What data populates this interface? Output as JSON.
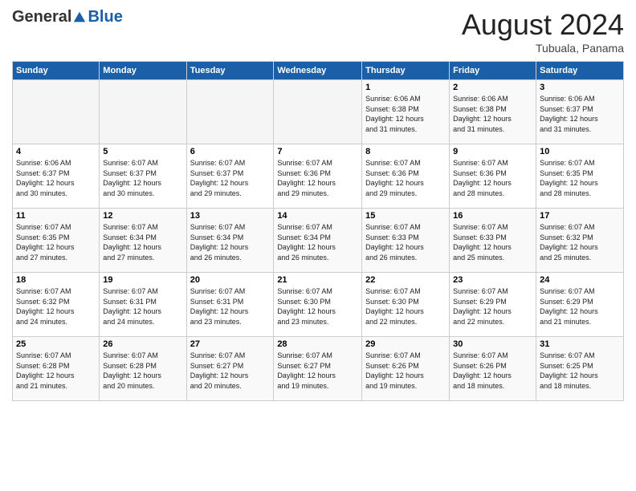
{
  "logo": {
    "general": "General",
    "blue": "Blue"
  },
  "header": {
    "month_title": "August 2024",
    "location": "Tubuala, Panama"
  },
  "weekdays": [
    "Sunday",
    "Monday",
    "Tuesday",
    "Wednesday",
    "Thursday",
    "Friday",
    "Saturday"
  ],
  "weeks": [
    [
      {
        "day": "",
        "info": ""
      },
      {
        "day": "",
        "info": ""
      },
      {
        "day": "",
        "info": ""
      },
      {
        "day": "",
        "info": ""
      },
      {
        "day": "1",
        "info": "Sunrise: 6:06 AM\nSunset: 6:38 PM\nDaylight: 12 hours\nand 31 minutes."
      },
      {
        "day": "2",
        "info": "Sunrise: 6:06 AM\nSunset: 6:38 PM\nDaylight: 12 hours\nand 31 minutes."
      },
      {
        "day": "3",
        "info": "Sunrise: 6:06 AM\nSunset: 6:37 PM\nDaylight: 12 hours\nand 31 minutes."
      }
    ],
    [
      {
        "day": "4",
        "info": "Sunrise: 6:06 AM\nSunset: 6:37 PM\nDaylight: 12 hours\nand 30 minutes."
      },
      {
        "day": "5",
        "info": "Sunrise: 6:07 AM\nSunset: 6:37 PM\nDaylight: 12 hours\nand 30 minutes."
      },
      {
        "day": "6",
        "info": "Sunrise: 6:07 AM\nSunset: 6:37 PM\nDaylight: 12 hours\nand 29 minutes."
      },
      {
        "day": "7",
        "info": "Sunrise: 6:07 AM\nSunset: 6:36 PM\nDaylight: 12 hours\nand 29 minutes."
      },
      {
        "day": "8",
        "info": "Sunrise: 6:07 AM\nSunset: 6:36 PM\nDaylight: 12 hours\nand 29 minutes."
      },
      {
        "day": "9",
        "info": "Sunrise: 6:07 AM\nSunset: 6:36 PM\nDaylight: 12 hours\nand 28 minutes."
      },
      {
        "day": "10",
        "info": "Sunrise: 6:07 AM\nSunset: 6:35 PM\nDaylight: 12 hours\nand 28 minutes."
      }
    ],
    [
      {
        "day": "11",
        "info": "Sunrise: 6:07 AM\nSunset: 6:35 PM\nDaylight: 12 hours\nand 27 minutes."
      },
      {
        "day": "12",
        "info": "Sunrise: 6:07 AM\nSunset: 6:34 PM\nDaylight: 12 hours\nand 27 minutes."
      },
      {
        "day": "13",
        "info": "Sunrise: 6:07 AM\nSunset: 6:34 PM\nDaylight: 12 hours\nand 26 minutes."
      },
      {
        "day": "14",
        "info": "Sunrise: 6:07 AM\nSunset: 6:34 PM\nDaylight: 12 hours\nand 26 minutes."
      },
      {
        "day": "15",
        "info": "Sunrise: 6:07 AM\nSunset: 6:33 PM\nDaylight: 12 hours\nand 26 minutes."
      },
      {
        "day": "16",
        "info": "Sunrise: 6:07 AM\nSunset: 6:33 PM\nDaylight: 12 hours\nand 25 minutes."
      },
      {
        "day": "17",
        "info": "Sunrise: 6:07 AM\nSunset: 6:32 PM\nDaylight: 12 hours\nand 25 minutes."
      }
    ],
    [
      {
        "day": "18",
        "info": "Sunrise: 6:07 AM\nSunset: 6:32 PM\nDaylight: 12 hours\nand 24 minutes."
      },
      {
        "day": "19",
        "info": "Sunrise: 6:07 AM\nSunset: 6:31 PM\nDaylight: 12 hours\nand 24 minutes."
      },
      {
        "day": "20",
        "info": "Sunrise: 6:07 AM\nSunset: 6:31 PM\nDaylight: 12 hours\nand 23 minutes."
      },
      {
        "day": "21",
        "info": "Sunrise: 6:07 AM\nSunset: 6:30 PM\nDaylight: 12 hours\nand 23 minutes."
      },
      {
        "day": "22",
        "info": "Sunrise: 6:07 AM\nSunset: 6:30 PM\nDaylight: 12 hours\nand 22 minutes."
      },
      {
        "day": "23",
        "info": "Sunrise: 6:07 AM\nSunset: 6:29 PM\nDaylight: 12 hours\nand 22 minutes."
      },
      {
        "day": "24",
        "info": "Sunrise: 6:07 AM\nSunset: 6:29 PM\nDaylight: 12 hours\nand 21 minutes."
      }
    ],
    [
      {
        "day": "25",
        "info": "Sunrise: 6:07 AM\nSunset: 6:28 PM\nDaylight: 12 hours\nand 21 minutes."
      },
      {
        "day": "26",
        "info": "Sunrise: 6:07 AM\nSunset: 6:28 PM\nDaylight: 12 hours\nand 20 minutes."
      },
      {
        "day": "27",
        "info": "Sunrise: 6:07 AM\nSunset: 6:27 PM\nDaylight: 12 hours\nand 20 minutes."
      },
      {
        "day": "28",
        "info": "Sunrise: 6:07 AM\nSunset: 6:27 PM\nDaylight: 12 hours\nand 19 minutes."
      },
      {
        "day": "29",
        "info": "Sunrise: 6:07 AM\nSunset: 6:26 PM\nDaylight: 12 hours\nand 19 minutes."
      },
      {
        "day": "30",
        "info": "Sunrise: 6:07 AM\nSunset: 6:26 PM\nDaylight: 12 hours\nand 18 minutes."
      },
      {
        "day": "31",
        "info": "Sunrise: 6:07 AM\nSunset: 6:25 PM\nDaylight: 12 hours\nand 18 minutes."
      }
    ]
  ]
}
